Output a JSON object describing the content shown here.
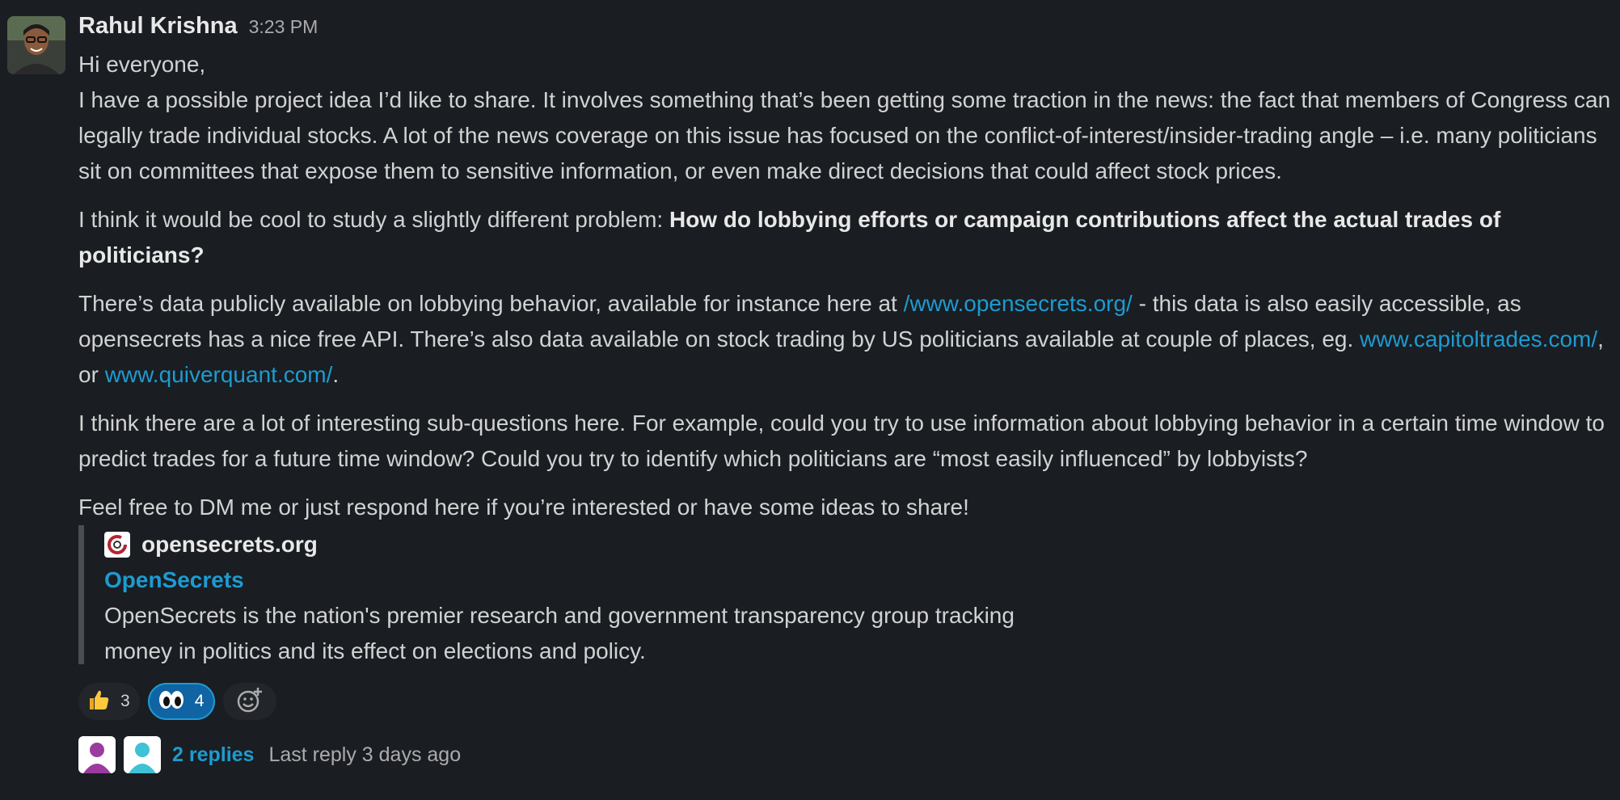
{
  "message": {
    "author": "Rahul Krishna",
    "time": "3:23 PM",
    "greeting": "Hi everyone,",
    "para1": "I have a possible project idea I’d like to share. It involves something that’s been getting some traction in the news: the fact that members of Congress can legally trade individual stocks. A lot of the news coverage on this issue has focused on the conflict-of-interest/insider-trading angle – i.e. many politicians sit on committees that expose them to sensitive information, or even make direct decisions that could affect stock prices.",
    "para2_lead": "I think it would be cool to study a slightly different problem: ",
    "para2_bold": "How do lobbying efforts or campaign contributions affect the actual trades of politicians?",
    "para3_a": "There’s data publicly available on lobbying behavior, available for instance here at ",
    "para3_link1": "/www.opensecrets.org/",
    "para3_b": " - this data is also easily accessible, as opensecrets has a nice free API. There’s also data available on stock trading by US politicians available at couple of places, eg. ",
    "para3_link2": "www.capitoltrades.com/",
    "para3_c": ", or ",
    "para3_link3": "www.quiverquant.com/",
    "para3_d": ".",
    "para4": "I think there are a lot of interesting sub-questions here. For example, could you try to use information about lobbying behavior in a certain time window to predict trades for a future time window? Could you try to identify which politicians are “most easily influenced” by lobbyists?",
    "para5": "Feel free to DM me or just respond here if you’re interested or have some ideas to share!"
  },
  "unfurl": {
    "site": "opensecrets.org",
    "title": "OpenSecrets",
    "description": "OpenSecrets is the nation's premier research and government transparency group tracking money in politics and its effect on elections and policy."
  },
  "reactions": [
    {
      "icon": "thumbs-up-icon",
      "count": "3",
      "active": false
    },
    {
      "icon": "eyes-icon",
      "count": "4",
      "active": true
    }
  ],
  "thread": {
    "replies": "2 replies",
    "last_reply": "Last reply 3 days ago"
  },
  "colors": {
    "background": "#1a1d21",
    "link": "#1d9bd1",
    "active_reaction": "#1164a3",
    "avatar1": "#9c3b9e",
    "avatar2": "#3fc1d6"
  }
}
